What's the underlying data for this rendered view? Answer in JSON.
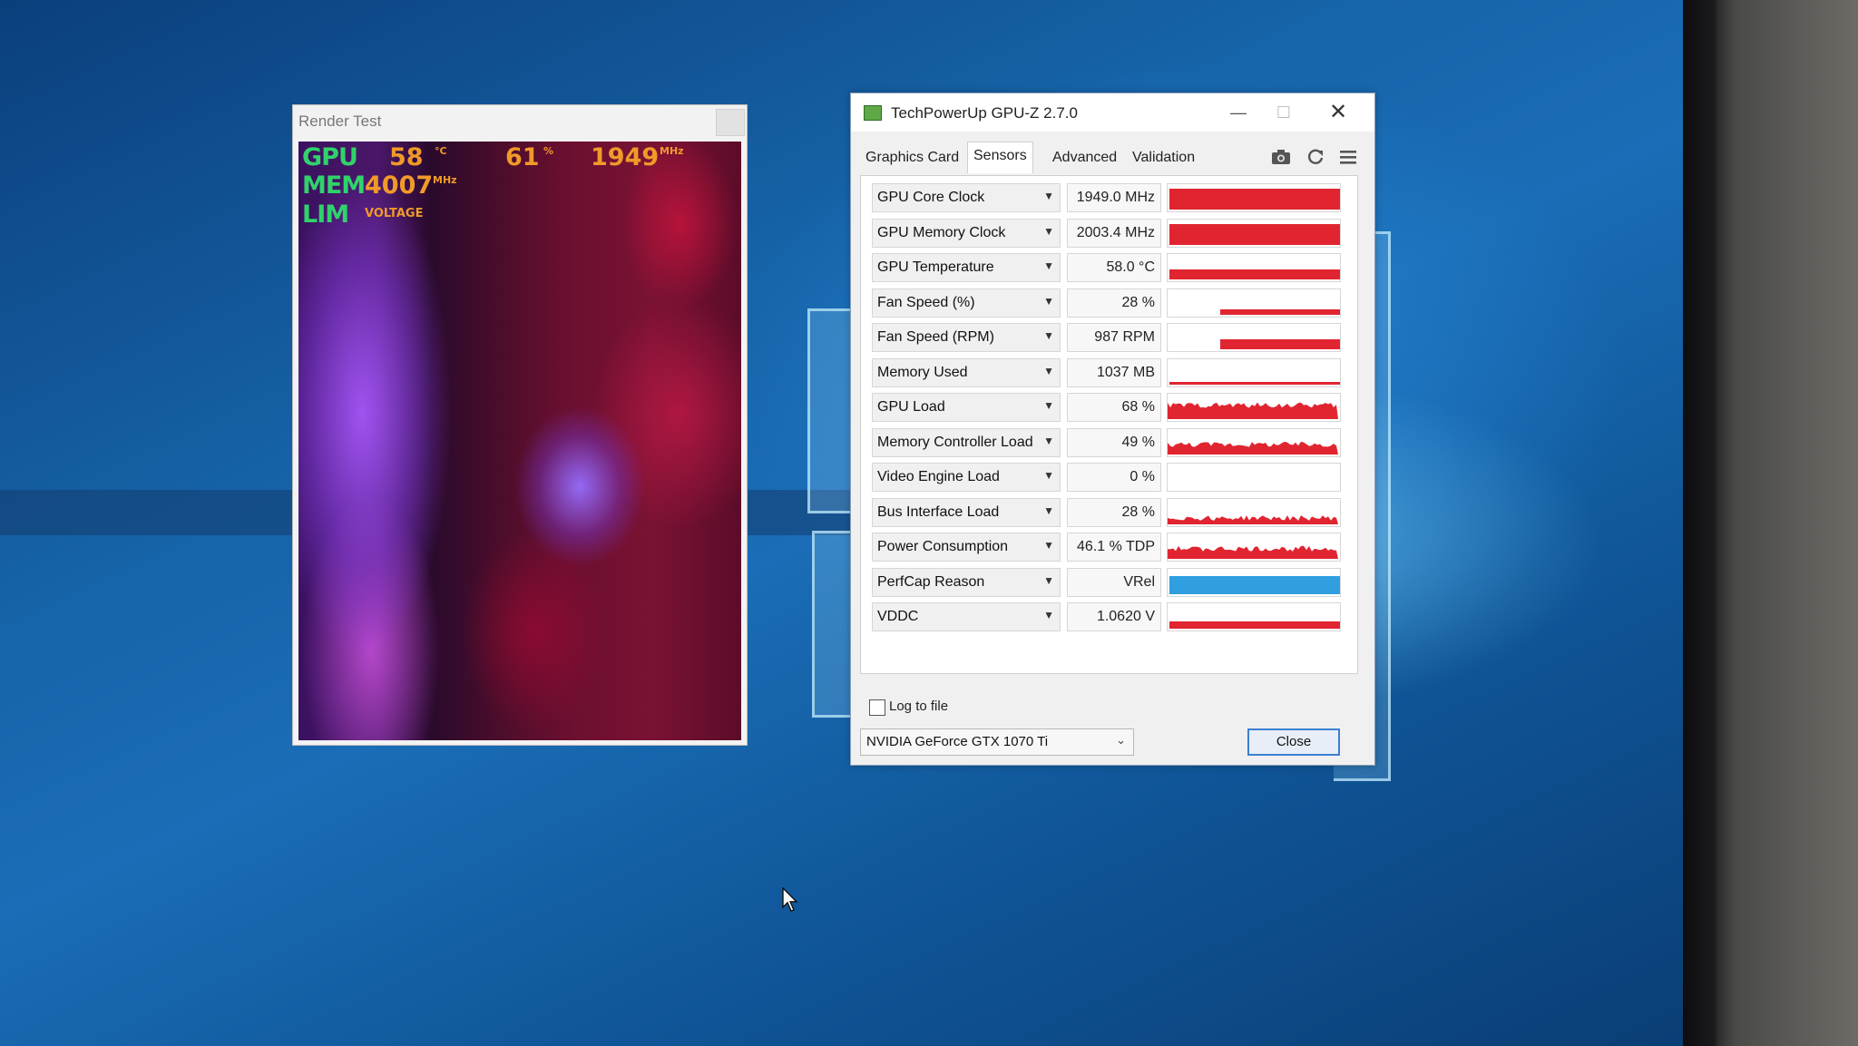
{
  "render_test": {
    "title": "Render Test",
    "osd": {
      "gpu_label": "GPU",
      "gpu_temp": "58",
      "gpu_temp_unit": "°C",
      "gpu_load": "61",
      "gpu_load_unit": "%",
      "gpu_clock": "1949",
      "gpu_clock_unit": "MHz",
      "mem_label": "MEM",
      "mem_clock": "4007",
      "mem_clock_unit": "MHz",
      "lim_label": "LIM",
      "lim_value": "VOLTAGE"
    }
  },
  "gpuz": {
    "title": "TechPowerUp GPU-Z 2.7.0",
    "window_controls": {
      "minimize": "—",
      "maximize": "☐",
      "close": "✕"
    },
    "tabs": [
      {
        "label": "Graphics Card"
      },
      {
        "label": "Sensors",
        "active": true
      },
      {
        "label": "Advanced"
      },
      {
        "label": "Validation"
      }
    ],
    "toolbar_icons": [
      "camera-icon",
      "refresh-icon",
      "menu-icon"
    ],
    "graph_color": "#e02531",
    "perfcap_color": "#2f9fe0",
    "sensors": [
      {
        "name": "GPU Core Clock",
        "value": "1949.0 MHz",
        "level": 0.98,
        "style": "full"
      },
      {
        "name": "GPU Memory Clock",
        "value": "2003.4 MHz",
        "level": 0.98,
        "style": "full"
      },
      {
        "name": "GPU Temperature",
        "value": "58.0 °C",
        "level": 0.4,
        "style": "line"
      },
      {
        "name": "Fan Speed (%)",
        "value": "28 %",
        "level": 0.2,
        "style": "line-partial"
      },
      {
        "name": "Fan Speed (RPM)",
        "value": "987 RPM",
        "level": 0.4,
        "style": "line-partial"
      },
      {
        "name": "Memory Used",
        "value": "1037 MB",
        "level": 0.08,
        "style": "line"
      },
      {
        "name": "GPU Load",
        "value": "68 %",
        "level": 0.55,
        "style": "noisy"
      },
      {
        "name": "Memory Controller Load",
        "value": "49 %",
        "level": 0.4,
        "style": "noisy"
      },
      {
        "name": "Video Engine Load",
        "value": "0 %",
        "level": 0,
        "style": "empty"
      },
      {
        "name": "Bus Interface Load",
        "value": "28 %",
        "level": 0.25,
        "style": "noisy"
      },
      {
        "name": "Power Consumption",
        "value": "46.1 % TDP",
        "level": 0.4,
        "style": "noisy"
      },
      {
        "name": "PerfCap Reason",
        "value": "VRel",
        "level": 0.85,
        "style": "perfcap"
      },
      {
        "name": "VDDC",
        "value": "1.0620 V",
        "level": 0.3,
        "style": "line"
      }
    ],
    "log_to_file_label": "Log to file",
    "log_to_file_checked": false,
    "gpu_select_value": "NVIDIA GeForce GTX 1070 Ti",
    "close_button_label": "Close"
  }
}
